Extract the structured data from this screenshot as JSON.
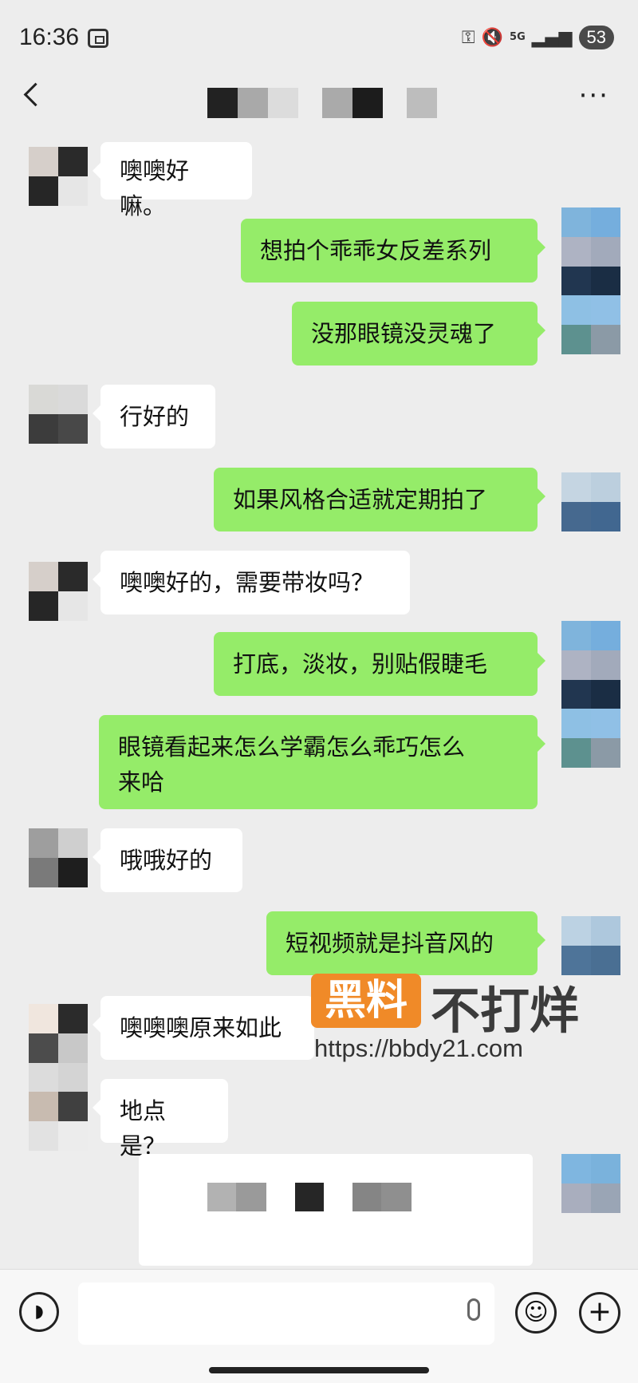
{
  "status_bar": {
    "time": "16:36",
    "network": "5G",
    "battery": "53"
  },
  "nav": {
    "more_label": "···"
  },
  "messages": [
    {
      "side": "in",
      "text": "噢噢好嘛。"
    },
    {
      "side": "out",
      "text": "想拍个乖乖女反差系列"
    },
    {
      "side": "out",
      "text": "没那眼镜没灵魂了"
    },
    {
      "side": "in",
      "text": "行好的"
    },
    {
      "side": "out",
      "text": "如果风格合适就定期拍了"
    },
    {
      "side": "in",
      "text": "噢噢好的，需要带妆吗？"
    },
    {
      "side": "out",
      "text": "打底，淡妆，别贴假睫毛"
    },
    {
      "side": "out",
      "text": "眼镜看起来怎么学霸怎么乖巧怎么\n来哈"
    },
    {
      "side": "in",
      "text": "哦哦好的"
    },
    {
      "side": "out",
      "text": "短视频就是抖音风的"
    },
    {
      "side": "in",
      "text": "噢噢噢原来如此"
    },
    {
      "side": "in",
      "text": "地点是？"
    }
  ],
  "watermark": {
    "badge": "黑料",
    "text": "不打烊",
    "url": "https://bbdy21.com"
  },
  "input_bar": {
    "placeholder": ""
  },
  "colors": {
    "background": "#ededed",
    "outgoing_bubble": "#95ec69",
    "incoming_bubble": "#ffffff",
    "watermark_orange": "#f08a28"
  },
  "icons": [
    "scan-icon",
    "key-icon",
    "mute-icon",
    "signal-icon",
    "back-icon",
    "more-icon",
    "voice-icon",
    "mic-icon",
    "emoji-icon",
    "plus-icon"
  ]
}
